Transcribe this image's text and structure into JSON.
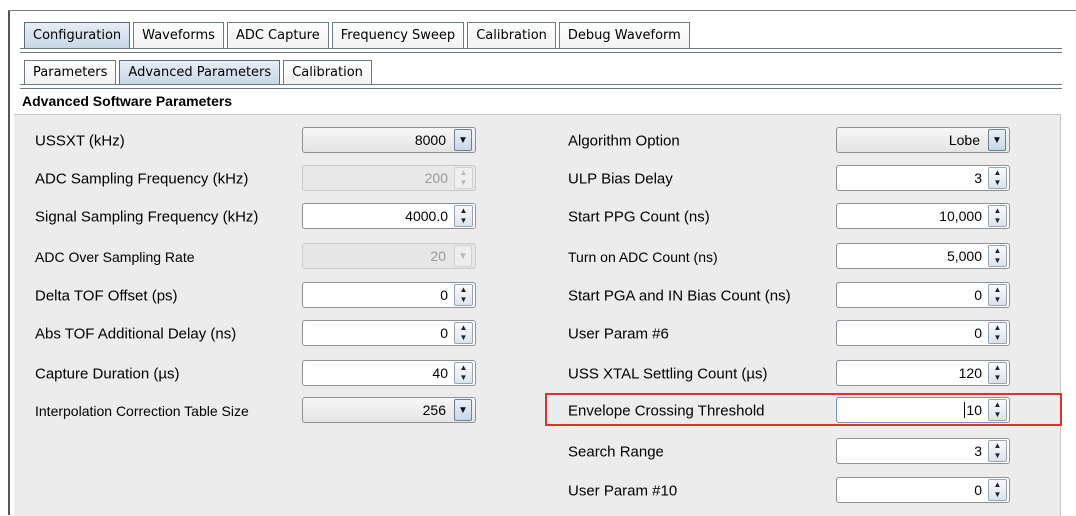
{
  "tabs": {
    "main": [
      "Configuration",
      "Waveforms",
      "ADC Capture",
      "Frequency Sweep",
      "Calibration",
      "Debug Waveform"
    ],
    "sub": [
      "Parameters",
      "Advanced Parameters",
      "Calibration"
    ]
  },
  "section_title": "Advanced Software Parameters",
  "left": [
    {
      "label": "USSXT (kHz)",
      "value": "8000",
      "control": "combo"
    },
    {
      "label": "ADC Sampling Frequency (kHz)",
      "value": "200",
      "control": "spinner-disabled"
    },
    {
      "label": "Signal Sampling Frequency (kHz)",
      "value": "4000.0",
      "control": "spinner"
    },
    {
      "label": "ADC Over Sampling Rate",
      "value": "20",
      "control": "combo-disabled"
    },
    {
      "label": "Delta TOF Offset (ps)",
      "value": "0",
      "control": "spinner"
    },
    {
      "label": "Abs TOF Additional Delay (ns)",
      "value": "0",
      "control": "spinner"
    },
    {
      "label": "Capture Duration (µs)",
      "value": "40",
      "control": "spinner"
    },
    {
      "label": "Interpolation Correction Table Size",
      "value": "256",
      "control": "combo"
    }
  ],
  "right": [
    {
      "label": "Algorithm Option",
      "value": "Lobe",
      "control": "combo"
    },
    {
      "label": "ULP Bias Delay",
      "value": "3",
      "control": "spinner"
    },
    {
      "label": "Start PPG Count (ns)",
      "value": "10,000",
      "control": "spinner"
    },
    {
      "label": "Turn on ADC Count (ns)",
      "value": "5,000",
      "control": "spinner"
    },
    {
      "label": "Start PGA and IN Bias Count (ns)",
      "value": "0",
      "control": "spinner"
    },
    {
      "label": "User Param #6",
      "value": "0",
      "control": "spinner"
    },
    {
      "label": "USS XTAL Settling Count (µs)",
      "value": "120",
      "control": "spinner"
    },
    {
      "label": "Envelope Crossing Threshold",
      "value": "10",
      "control": "spinner"
    },
    {
      "label": "Search Range",
      "value": "3",
      "control": "spinner"
    },
    {
      "label": "User Param #10",
      "value": "0",
      "control": "spinner"
    }
  ],
  "colors": {
    "highlight": "#e03030",
    "panel": "#ececec",
    "active_tab": "#c7d6e6"
  }
}
